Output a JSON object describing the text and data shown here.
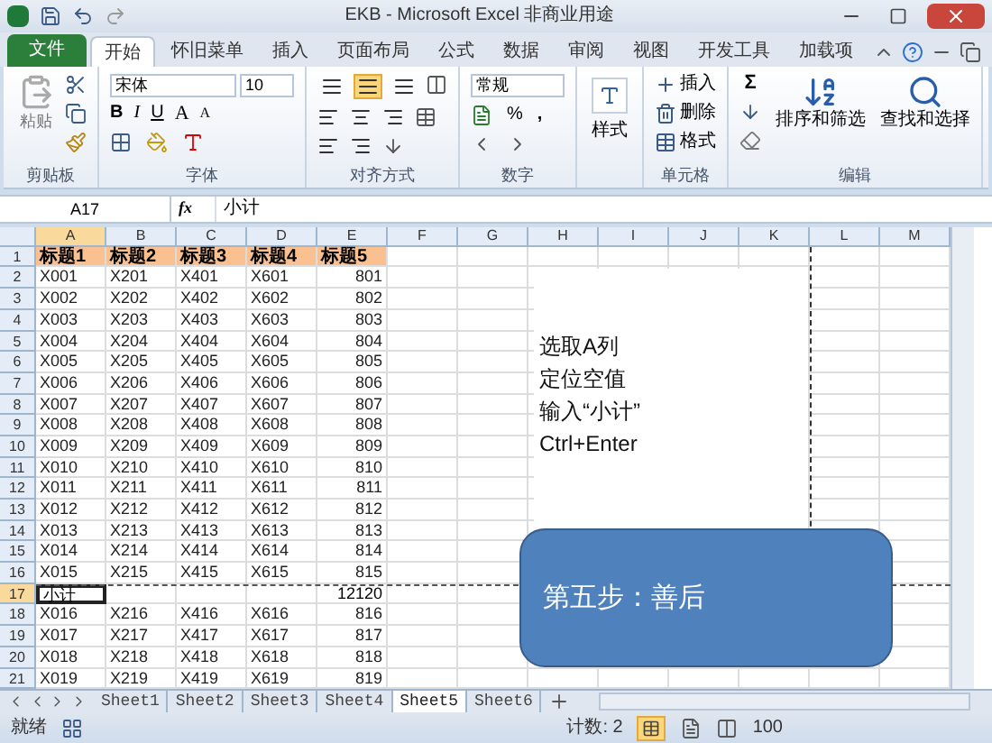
{
  "title_bar": {
    "title": "EKB - Microsoft Excel 非商业用途"
  },
  "ribbon_tabs": [
    {
      "label": "文件",
      "kind": "file",
      "selected": false
    },
    {
      "label": "开始",
      "kind": "tab",
      "selected": true
    },
    {
      "label": "怀旧菜单",
      "kind": "tab",
      "selected": false
    },
    {
      "label": "插入",
      "kind": "tab",
      "selected": false
    },
    {
      "label": "页面布局",
      "kind": "tab",
      "selected": false
    },
    {
      "label": "公式",
      "kind": "tab",
      "selected": false
    },
    {
      "label": "数据",
      "kind": "tab",
      "selected": false
    },
    {
      "label": "审阅",
      "kind": "tab",
      "selected": false
    },
    {
      "label": "视图",
      "kind": "tab",
      "selected": false
    },
    {
      "label": "开发工具",
      "kind": "tab",
      "selected": false
    },
    {
      "label": "加载项",
      "kind": "tab",
      "selected": false
    }
  ],
  "ribbon": {
    "groups": [
      {
        "kind": "clipboard",
        "label": "剪贴板",
        "paste": "粘贴"
      },
      {
        "kind": "font",
        "label": "字体",
        "font_name": "宋体",
        "font_size": "10",
        "bold": "B",
        "italic": "I",
        "underline": "U",
        "grow": "A",
        "shrink": "A"
      },
      {
        "kind": "alignment",
        "label": "对齐方式",
        "vertical_align": [
          {
            "selected": false
          },
          {
            "selected": true
          },
          {
            "selected": false
          }
        ]
      },
      {
        "kind": "number",
        "label": "数字",
        "format": "常规",
        "percent": "%",
        "comma": ","
      },
      {
        "kind": "styles",
        "button": "样式"
      },
      {
        "kind": "cells",
        "label": "单元格",
        "items": [
          "插入",
          "删除",
          "格式"
        ]
      },
      {
        "kind": "editing",
        "label": "编辑",
        "sum": "Σ",
        "items": [
          "排序和筛选",
          "查找和选择"
        ]
      }
    ]
  },
  "formula_bar": {
    "name_box": "A17",
    "function_label": "fx",
    "formula": "小计"
  },
  "sheet": {
    "columns": [
      {
        "label": "A",
        "selected": true
      },
      {
        "label": "B",
        "selected": false
      },
      {
        "label": "C",
        "selected": false
      },
      {
        "label": "D",
        "selected": false
      },
      {
        "label": "E",
        "selected": false
      },
      {
        "label": "F",
        "selected": false
      },
      {
        "label": "G",
        "selected": false
      },
      {
        "label": "H",
        "selected": false
      },
      {
        "label": "I",
        "selected": false
      },
      {
        "label": "J",
        "selected": false
      },
      {
        "label": "K",
        "selected": false
      },
      {
        "label": "L",
        "selected": false
      },
      {
        "label": "M",
        "selected": false
      }
    ],
    "rows": [
      {
        "row": "1",
        "kind": "header",
        "selected": false,
        "cells": [
          "标题1",
          "标题2",
          "标题3",
          "标题4",
          "标题5"
        ]
      },
      {
        "row": "2",
        "kind": "data",
        "selected": false,
        "cells": [
          "X001",
          "X201",
          "X401",
          "X601",
          "801"
        ]
      },
      {
        "row": "3",
        "kind": "data",
        "selected": false,
        "cells": [
          "X002",
          "X202",
          "X402",
          "X602",
          "802"
        ]
      },
      {
        "row": "4",
        "kind": "data",
        "selected": false,
        "cells": [
          "X003",
          "X203",
          "X403",
          "X603",
          "803"
        ]
      },
      {
        "row": "5",
        "kind": "data",
        "selected": false,
        "cells": [
          "X004",
          "X204",
          "X404",
          "X604",
          "804"
        ]
      },
      {
        "row": "6",
        "kind": "data",
        "selected": false,
        "cells": [
          "X005",
          "X205",
          "X405",
          "X605",
          "805"
        ]
      },
      {
        "row": "7",
        "kind": "data",
        "selected": false,
        "cells": [
          "X006",
          "X206",
          "X406",
          "X606",
          "806"
        ]
      },
      {
        "row": "8",
        "kind": "data",
        "selected": false,
        "cells": [
          "X007",
          "X207",
          "X407",
          "X607",
          "807"
        ]
      },
      {
        "row": "9",
        "kind": "data",
        "selected": false,
        "cells": [
          "X008",
          "X208",
          "X408",
          "X608",
          "808"
        ]
      },
      {
        "row": "10",
        "kind": "data",
        "selected": false,
        "cells": [
          "X009",
          "X209",
          "X409",
          "X609",
          "809"
        ]
      },
      {
        "row": "11",
        "kind": "data",
        "selected": false,
        "cells": [
          "X010",
          "X210",
          "X410",
          "X610",
          "810"
        ]
      },
      {
        "row": "12",
        "kind": "data",
        "selected": false,
        "cells": [
          "X011",
          "X211",
          "X411",
          "X611",
          "811"
        ]
      },
      {
        "row": "13",
        "kind": "data",
        "selected": false,
        "cells": [
          "X012",
          "X212",
          "X412",
          "X612",
          "812"
        ]
      },
      {
        "row": "14",
        "kind": "data",
        "selected": false,
        "cells": [
          "X013",
          "X213",
          "X413",
          "X613",
          "813"
        ]
      },
      {
        "row": "15",
        "kind": "data",
        "selected": false,
        "cells": [
          "X014",
          "X214",
          "X414",
          "X614",
          "814"
        ]
      },
      {
        "row": "16",
        "kind": "data",
        "selected": false,
        "cells": [
          "X015",
          "X215",
          "X415",
          "X615",
          "815"
        ]
      },
      {
        "row": "17",
        "kind": "subtotal",
        "selected": true,
        "label": "小计",
        "total": "12120"
      },
      {
        "row": "18",
        "kind": "data",
        "selected": false,
        "cells": [
          "X016",
          "X216",
          "X416",
          "X616",
          "816"
        ]
      },
      {
        "row": "19",
        "kind": "data",
        "selected": false,
        "cells": [
          "X017",
          "X217",
          "X417",
          "X617",
          "817"
        ]
      },
      {
        "row": "20",
        "kind": "data",
        "selected": false,
        "cells": [
          "X018",
          "X218",
          "X418",
          "X618",
          "818"
        ]
      },
      {
        "row": "21",
        "kind": "data",
        "selected": false,
        "cells": [
          "X019",
          "X219",
          "X419",
          "X619",
          "819"
        ]
      }
    ]
  },
  "note": {
    "lines": [
      "选取A列",
      "定位空值",
      "输入“小计”",
      "Ctrl+Enter"
    ]
  },
  "callout": {
    "text": "第五步：善后"
  },
  "sheet_tabs": [
    {
      "label": "Sheet1",
      "selected": false
    },
    {
      "label": "Sheet2",
      "selected": false
    },
    {
      "label": "Sheet3",
      "selected": false
    },
    {
      "label": "Sheet4",
      "selected": false
    },
    {
      "label": "Sheet5",
      "selected": true
    },
    {
      "label": "Sheet6",
      "selected": false
    }
  ],
  "status_bar": {
    "status": "就绪",
    "count": "计数: 2",
    "zoom": "100"
  }
}
